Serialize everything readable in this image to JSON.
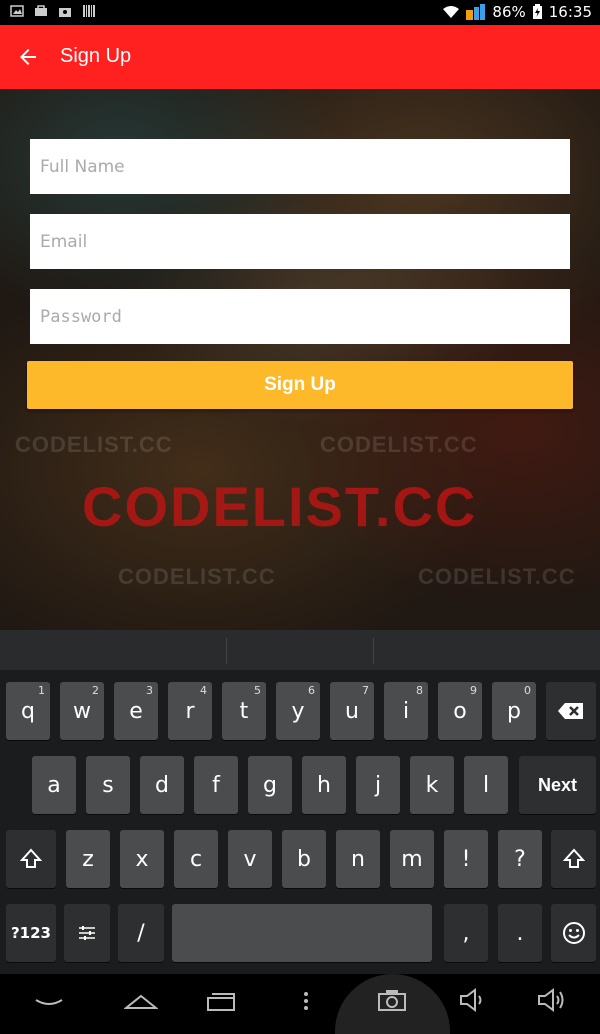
{
  "status_bar": {
    "battery": "86%",
    "time": "16:35"
  },
  "app_bar": {
    "title": "Sign Up"
  },
  "form": {
    "full_name_placeholder": "Full Name",
    "email_placeholder": "Email",
    "password_placeholder": "Password",
    "submit_label": "Sign Up"
  },
  "watermark": {
    "big": "CODELIST.CC",
    "small": "CODELIST.CC"
  },
  "keyboard": {
    "row1": [
      {
        "key": "q",
        "num": "1"
      },
      {
        "key": "w",
        "num": "2"
      },
      {
        "key": "e",
        "num": "3"
      },
      {
        "key": "r",
        "num": "4"
      },
      {
        "key": "t",
        "num": "5"
      },
      {
        "key": "y",
        "num": "6"
      },
      {
        "key": "u",
        "num": "7"
      },
      {
        "key": "i",
        "num": "8"
      },
      {
        "key": "o",
        "num": "9"
      },
      {
        "key": "p",
        "num": "0"
      }
    ],
    "row2": [
      "a",
      "s",
      "d",
      "f",
      "g",
      "h",
      "j",
      "k",
      "l"
    ],
    "row3": [
      "z",
      "x",
      "c",
      "v",
      "b",
      "n",
      "m",
      "!",
      "?"
    ],
    "next_label": "Next",
    "symbols_label": "?123",
    "slash": "/",
    "comma": ",",
    "period": "."
  },
  "icons": {
    "back": "arrow-left-icon",
    "backspace": "backspace-icon",
    "shift": "shift-icon",
    "settings": "keyboard-settings-icon",
    "emoji": "emoji-icon",
    "nav_back": "nav-back-icon",
    "nav_home": "nav-home-icon",
    "nav_recents": "nav-recents-icon",
    "nav_menu": "nav-menu-icon",
    "screenshot": "camera-icon",
    "vol_down": "volume-down-icon",
    "vol_up": "volume-up-icon"
  },
  "colors": {
    "app_bar": "#ff2020",
    "button": "#fdb92a"
  }
}
